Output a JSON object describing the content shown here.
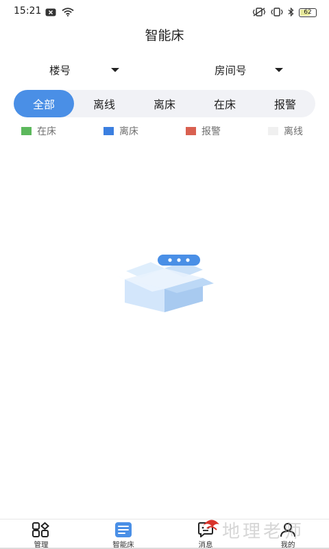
{
  "status_bar": {
    "time": "15:21",
    "battery": "62",
    "icons": [
      "notification-x-icon",
      "wifi-icon",
      "vibrate-icon",
      "nfc-icon",
      "bluetooth-icon",
      "battery-icon"
    ]
  },
  "header": {
    "title": "智能床"
  },
  "filters": {
    "floor_label": "楼号",
    "room_label": "房间号"
  },
  "tabs": [
    {
      "label": "全部",
      "active": true
    },
    {
      "label": "离线",
      "active": false
    },
    {
      "label": "离床",
      "active": false
    },
    {
      "label": "在床",
      "active": false
    },
    {
      "label": "报警",
      "active": false
    }
  ],
  "legend": [
    {
      "label": "在床",
      "color": "#5cb85c"
    },
    {
      "label": "离床",
      "color": "#3b7fe0"
    },
    {
      "label": "报警",
      "color": "#d96050"
    },
    {
      "label": "离线",
      "color": "#f0f0f0"
    }
  ],
  "empty_state": {
    "icon": "empty-box-icon"
  },
  "bottom_nav": [
    {
      "label": "管理",
      "icon": "grid-icon",
      "active": false
    },
    {
      "label": "智能床",
      "icon": "list-doc-icon",
      "active": true
    },
    {
      "label": "消息",
      "icon": "chat-icon",
      "active": false
    },
    {
      "label": "我的",
      "icon": "user-icon",
      "active": false
    }
  ],
  "watermark": {
    "text": "地理老师"
  },
  "colors": {
    "accent": "#4a8fe6",
    "tab_track": "#f1f2f6"
  }
}
